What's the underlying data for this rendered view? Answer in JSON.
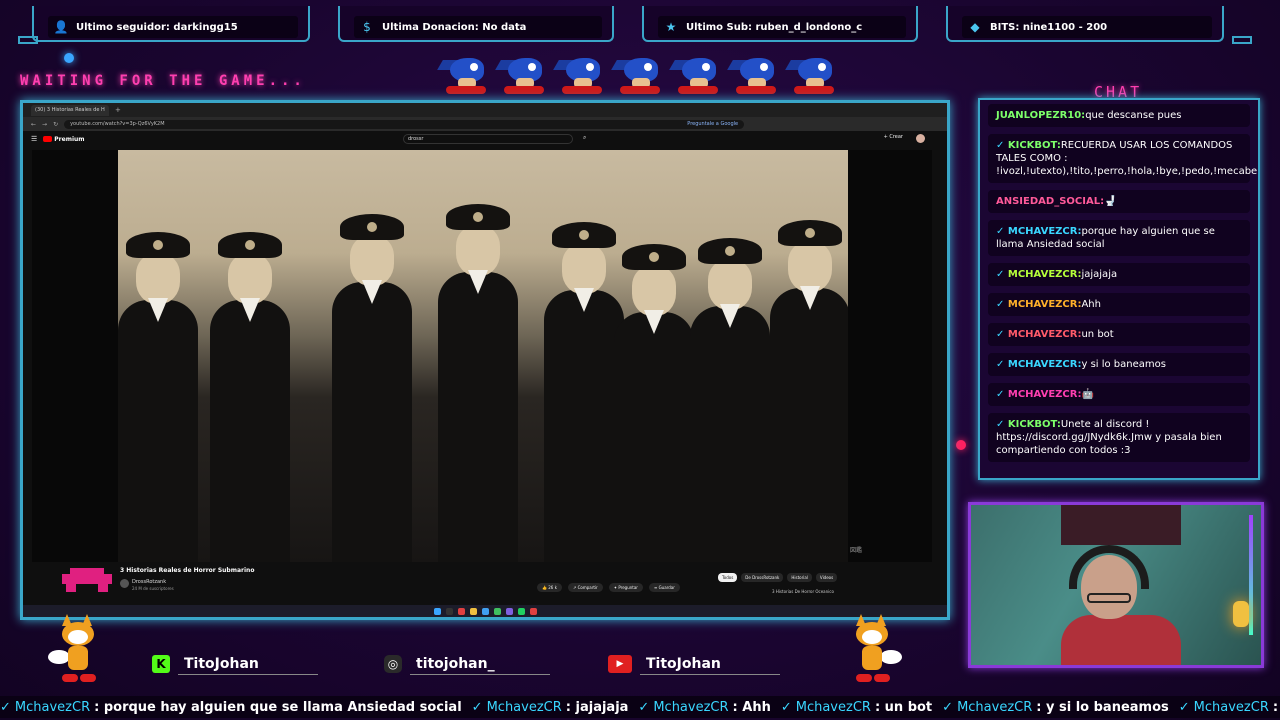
{
  "top_stats": [
    {
      "icon": "user-icon",
      "text": "Ultimo seguidor: darkingg15"
    },
    {
      "icon": "dollar-icon",
      "text": "Ultima Donacion: No data"
    },
    {
      "icon": "star-icon",
      "text": "Ultimo Sub: ruben_d_londono_c"
    },
    {
      "icon": "diamond-icon",
      "text": "BITS: nine1100 - 200"
    }
  ],
  "waiting_text": "WAITING FOR THE GAME...",
  "chat_title": "CHAT",
  "browser": {
    "tab_label": "(30) 3 Historias Reales de H",
    "url": "youtube.com/watch?v=3p-Qz6VyK2M",
    "ask_google": "Preguntale a Google",
    "yt_brand": "Premium",
    "search_query": "drossr",
    "create_label": "+ Crear"
  },
  "video": {
    "title": "3 Historias Reales de Horror Submarino",
    "channel": "DrossRotzank",
    "subscribers": "24 M de suscriptores",
    "likes": "26 k",
    "share": "Compartir",
    "ask": "Preguntar",
    "save": "Guardar",
    "caption_tag": "図鑑",
    "related_tags": [
      "Todos",
      "De DrossRotzank",
      "Historial",
      "Videos"
    ],
    "related_video": "3 Historias De Horror Oceanico"
  },
  "chat_messages": [
    {
      "user": "JUANLOPEZR10:",
      "user_color": "#7dff6a",
      "text": "que descanse pues",
      "check": false
    },
    {
      "user": "KICKBOT:",
      "user_color": "#7dff6a",
      "text": "RECUERDA USAR LOS COMANDOS TALES COMO : !ivozl,!utexto),!tito,!perro,!hola,!bye,!pedo,!mecabe,!manco,!cuernos,!facha,!memide,!maldad,!lis,!chupi,!clip!",
      "check": true
    },
    {
      "user": "ANSIEDAD_SOCIAL:",
      "user_color": "#ff5a9a",
      "text": "🚽",
      "check": false
    },
    {
      "user": "MCHAVEZCR:",
      "user_color": "#3ad7ff",
      "text": "porque hay alguien que se llama Ansiedad social",
      "check": true
    },
    {
      "user": "MCHAVEZCR:",
      "user_color": "#b6ff3a",
      "text": "jajajaja",
      "check": true
    },
    {
      "user": "MCHAVEZCR:",
      "user_color": "#ffb02a",
      "text": "Ahh",
      "check": true
    },
    {
      "user": "MCHAVEZCR:",
      "user_color": "#ff5a6a",
      "text": "un bot",
      "check": true
    },
    {
      "user": "MCHAVEZCR:",
      "user_color": "#3ad7ff",
      "text": "y si lo baneamos",
      "check": true
    },
    {
      "user": "MCHAVEZCR:",
      "user_color": "#ff3fb0",
      "text": "🤖",
      "check": true
    },
    {
      "user": "KICKBOT:",
      "user_color": "#7dff6a",
      "text": "Unete al discord ! https://discord.gg/JNydk6k.Jmw y pasala bien compartiendo con todos :3",
      "check": true
    }
  ],
  "socials": [
    {
      "icon": "kick-icon",
      "glyph": "K",
      "name": "TitoJohan"
    },
    {
      "icon": "instagram-icon",
      "glyph": "◎",
      "name": "titojohan_"
    },
    {
      "icon": "youtube-icon",
      "glyph": "▶",
      "name": "TitoJohan"
    }
  ],
  "ticker": [
    {
      "user": "MchavezCR",
      "text": ": porque hay alguien que se llama Ansiedad social"
    },
    {
      "user": "MchavezCR",
      "text": ": jajajaja"
    },
    {
      "user": "MchavezCR",
      "text": ": Ahh"
    },
    {
      "user": "MchavezCR",
      "text": ": un bot"
    },
    {
      "user": "MchavezCR",
      "text": ": y si lo baneamos"
    },
    {
      "user": "MchavezCR",
      "text": ":"
    }
  ],
  "colors": {
    "frame_cyan": "#3aa6c9",
    "neon_pink": "#ff3fb0",
    "cam_purple": "#8a3ad8",
    "background": "#1a0530"
  }
}
